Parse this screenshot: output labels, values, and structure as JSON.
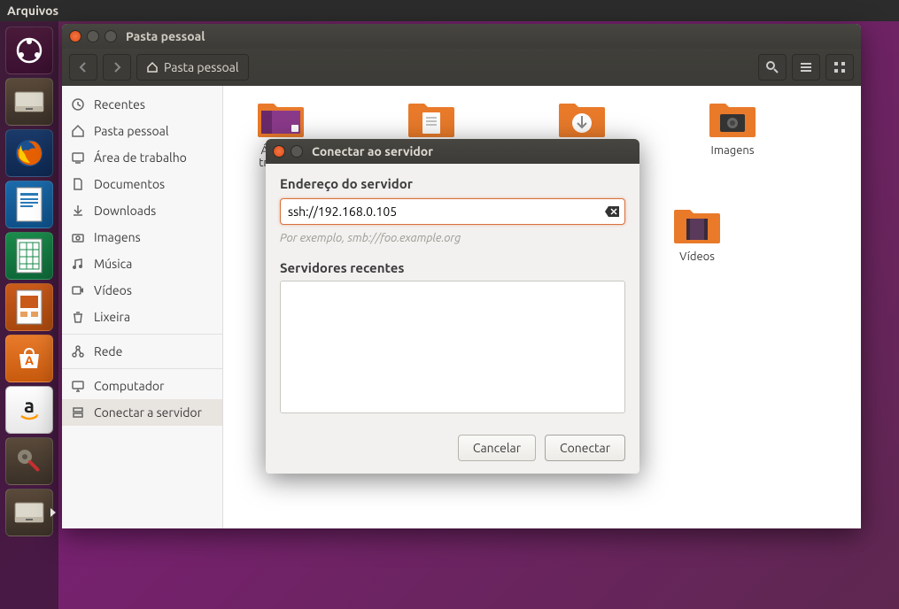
{
  "menubar": {
    "app": "Arquivos"
  },
  "window": {
    "title": "Pasta pessoal",
    "breadcrumb": "Pasta pessoal"
  },
  "sidebar": {
    "items": [
      {
        "label": "Recentes"
      },
      {
        "label": "Pasta pessoal"
      },
      {
        "label": "Área de trabalho"
      },
      {
        "label": "Documentos"
      },
      {
        "label": "Downloads"
      },
      {
        "label": "Imagens"
      },
      {
        "label": "Música"
      },
      {
        "label": "Vídeos"
      },
      {
        "label": "Lixeira"
      },
      {
        "label": "Rede"
      },
      {
        "label": "Computador"
      },
      {
        "label": "Conectar a servidor"
      }
    ]
  },
  "folders": {
    "desktop": "Área de trabalho",
    "documents": "Documentos",
    "downloads": "Downloads",
    "pictures": "Imagens",
    "videos": "Vídeos"
  },
  "dialog": {
    "title": "Conectar ao servidor",
    "address_label": "Endereço do servidor",
    "address_value": "ssh://192.168.0.105",
    "hint": "Por exemplo, smb://foo.example.org",
    "recent_label": "Servidores recentes",
    "cancel": "Cancelar",
    "connect": "Conectar"
  }
}
